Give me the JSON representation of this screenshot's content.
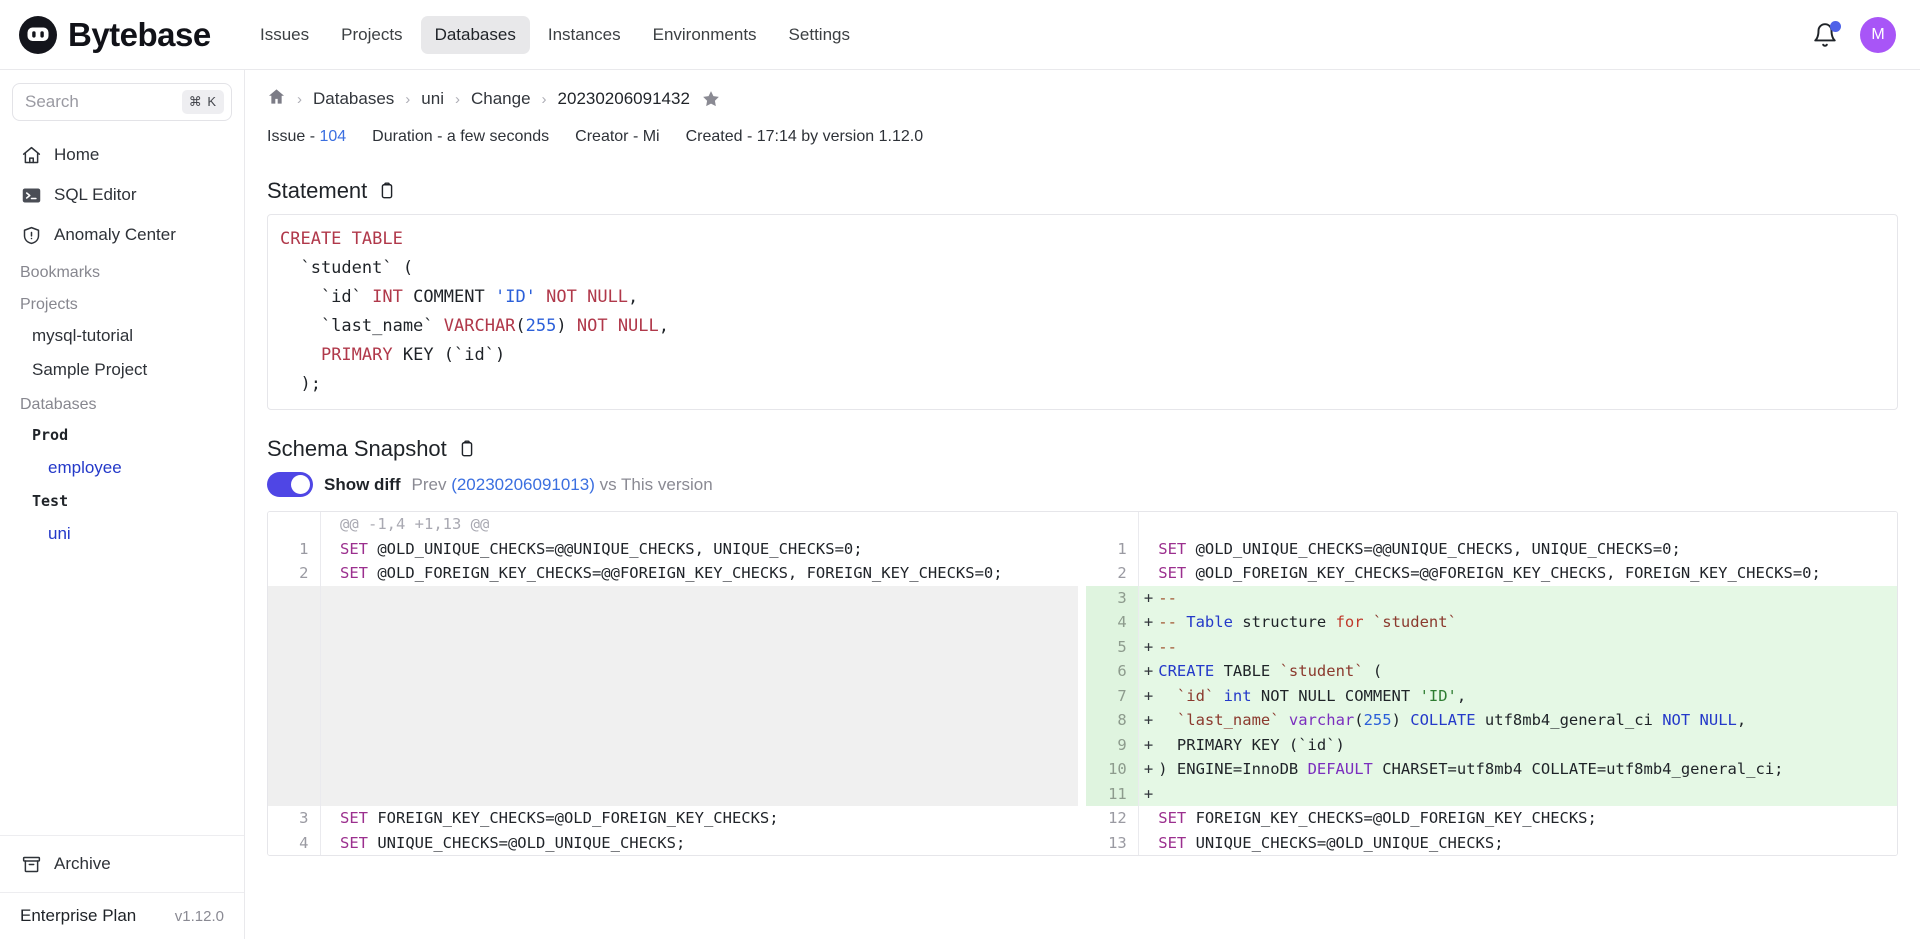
{
  "app": {
    "brand": "Bytebase"
  },
  "topnav": {
    "items": [
      {
        "label": "Issues",
        "active": false
      },
      {
        "label": "Projects",
        "active": false
      },
      {
        "label": "Databases",
        "active": true
      },
      {
        "label": "Instances",
        "active": false
      },
      {
        "label": "Environments",
        "active": false
      },
      {
        "label": "Settings",
        "active": false
      }
    ],
    "notification_icon": "bell-icon",
    "avatar_initial": "M",
    "accent": "#4f46e5"
  },
  "sidebar": {
    "search": {
      "placeholder": "Search",
      "shortcut": "⌘ K"
    },
    "nav": [
      {
        "label": "Home",
        "icon": "home-icon"
      },
      {
        "label": "SQL Editor",
        "icon": "terminal-icon"
      },
      {
        "label": "Anomaly Center",
        "icon": "shield-alert-icon"
      }
    ],
    "bookmarks_header": "Bookmarks",
    "projects_header": "Projects",
    "projects": [
      {
        "label": "mysql-tutorial"
      },
      {
        "label": "Sample Project"
      }
    ],
    "databases_header": "Databases",
    "environments": [
      {
        "label": "Prod",
        "databases": [
          {
            "label": "employee"
          }
        ]
      },
      {
        "label": "Test",
        "databases": [
          {
            "label": "uni"
          }
        ]
      }
    ],
    "archive": {
      "label": "Archive",
      "icon": "archive-icon"
    },
    "plan": {
      "name": "Enterprise Plan",
      "version": "v1.12.0"
    }
  },
  "breadcrumb": {
    "home_icon": "home-icon",
    "items": [
      {
        "label": "Databases",
        "link": true
      },
      {
        "label": "uni",
        "link": true
      },
      {
        "label": "Change",
        "link": true
      },
      {
        "label": "20230206091432",
        "link": false
      }
    ],
    "separator": "›",
    "star_icon": "star-filled-icon"
  },
  "meta": {
    "issue_label": "Issue - ",
    "issue_value": "104",
    "duration": "Duration - a few seconds",
    "creator": "Creator - Mi",
    "created": "Created - 17:14 by version 1.12.0"
  },
  "statement": {
    "title": "Statement",
    "copy_icon": "clipboard-icon",
    "lines": [
      [
        {
          "t": "CREATE TABLE",
          "c": "k"
        }
      ],
      [
        {
          "t": "  `student` (",
          "c": "p"
        }
      ],
      [
        {
          "t": "    `id` ",
          "c": "p"
        },
        {
          "t": "INT",
          "c": "k"
        },
        {
          "t": " COMMENT ",
          "c": "p"
        },
        {
          "t": "'ID'",
          "c": "n"
        },
        {
          "t": " NOT NULL",
          "c": "k"
        },
        {
          "t": ",",
          "c": "p"
        }
      ],
      [
        {
          "t": "    `last_name` ",
          "c": "p"
        },
        {
          "t": "VARCHAR",
          "c": "k"
        },
        {
          "t": "(",
          "c": "p"
        },
        {
          "t": "255",
          "c": "n"
        },
        {
          "t": ")",
          "c": "p"
        },
        {
          "t": " NOT NULL",
          "c": "k"
        },
        {
          "t": ",",
          "c": "p"
        }
      ],
      [
        {
          "t": "    ",
          "c": "p"
        },
        {
          "t": "PRIMARY",
          "c": "k"
        },
        {
          "t": " KEY (`id`)",
          "c": "p"
        }
      ],
      [
        {
          "t": "  );",
          "c": "p"
        }
      ]
    ]
  },
  "schema_snapshot": {
    "title": "Schema Snapshot",
    "copy_icon": "clipboard-icon",
    "show_diff_label": "Show diff",
    "toggle_on": true,
    "prev_label": "Prev",
    "prev_version": "(20230206091013)",
    "vs_label": "vs This version"
  },
  "diff": {
    "hunk_header": "@@ -1,4 +1,13 @@",
    "rows": [
      {
        "type": "hunk",
        "left_num": "",
        "right_num": "",
        "left": [],
        "right": []
      },
      {
        "type": "ctx",
        "left_num": "1",
        "right_num": "1",
        "left": [
          {
            "t": "SET",
            "c": "dk"
          },
          {
            "t": " @OLD_UNIQUE_CHECKS=@@UNIQUE_CHECKS, UNIQUE_CHECKS=0;",
            "c": ""
          }
        ],
        "right": [
          {
            "t": "SET",
            "c": "dk"
          },
          {
            "t": " @OLD_UNIQUE_CHECKS=@@UNIQUE_CHECKS, UNIQUE_CHECKS=0;",
            "c": ""
          }
        ]
      },
      {
        "type": "ctx",
        "left_num": "2",
        "right_num": "2",
        "left": [
          {
            "t": "SET",
            "c": "dk"
          },
          {
            "t": " @OLD_FOREIGN_KEY_CHECKS=@@FOREIGN_KEY_CHECKS, FOREIGN_KEY_CHECKS=0;",
            "c": ""
          }
        ],
        "right": [
          {
            "t": "SET",
            "c": "dk"
          },
          {
            "t": " @OLD_FOREIGN_KEY_CHECKS=@@FOREIGN_KEY_CHECKS, FOREIGN_KEY_CHECKS=0;",
            "c": ""
          }
        ]
      },
      {
        "type": "add",
        "left_num": "",
        "right_num": "3",
        "left": [],
        "right": [
          {
            "t": "--",
            "c": "dc"
          }
        ]
      },
      {
        "type": "add",
        "left_num": "",
        "right_num": "4",
        "left": [],
        "right": [
          {
            "t": "-- ",
            "c": "dc"
          },
          {
            "t": "Table",
            "c": "db"
          },
          {
            "t": " structure ",
            "c": ""
          },
          {
            "t": "for",
            "c": "dr"
          },
          {
            "t": " `student`",
            "c": "dbr"
          }
        ]
      },
      {
        "type": "add",
        "left_num": "",
        "right_num": "5",
        "left": [],
        "right": [
          {
            "t": "--",
            "c": "dc"
          }
        ]
      },
      {
        "type": "add",
        "left_num": "",
        "right_num": "6",
        "left": [],
        "right": [
          {
            "t": "CREATE",
            "c": "db"
          },
          {
            "t": " TABLE ",
            "c": ""
          },
          {
            "t": "`student`",
            "c": "dbr"
          },
          {
            "t": " (",
            "c": ""
          }
        ]
      },
      {
        "type": "add",
        "left_num": "",
        "right_num": "7",
        "left": [],
        "right": [
          {
            "t": "  `id` ",
            "c": "dbr"
          },
          {
            "t": "int",
            "c": "db"
          },
          {
            "t": " NOT NULL COMMENT ",
            "c": ""
          },
          {
            "t": "'ID'",
            "c": "ds"
          },
          {
            "t": ",",
            "c": ""
          }
        ]
      },
      {
        "type": "add",
        "left_num": "",
        "right_num": "8",
        "left": [],
        "right": [
          {
            "t": "  `last_name` ",
            "c": "dbr"
          },
          {
            "t": "varchar",
            "c": "dp"
          },
          {
            "t": "(",
            "c": ""
          },
          {
            "t": "255",
            "c": "dn"
          },
          {
            "t": ") ",
            "c": ""
          },
          {
            "t": "COLLATE",
            "c": "db"
          },
          {
            "t": " utf8mb4_general_ci ",
            "c": ""
          },
          {
            "t": "NOT NULL",
            "c": "db"
          },
          {
            "t": ",",
            "c": ""
          }
        ]
      },
      {
        "type": "add",
        "left_num": "",
        "right_num": "9",
        "left": [],
        "right": [
          {
            "t": "  PRIMARY KEY (`id`)",
            "c": ""
          }
        ]
      },
      {
        "type": "add",
        "left_num": "",
        "right_num": "10",
        "left": [],
        "right": [
          {
            "t": ") ENGINE=InnoDB ",
            "c": ""
          },
          {
            "t": "DEFAULT",
            "c": "dp"
          },
          {
            "t": " CHARSET=utf8mb4 COLLATE=utf8mb4_general_ci;",
            "c": ""
          }
        ]
      },
      {
        "type": "add",
        "left_num": "",
        "right_num": "11",
        "left": [],
        "right": [
          {
            "t": "",
            "c": ""
          }
        ]
      },
      {
        "type": "ctx",
        "left_num": "3",
        "right_num": "12",
        "left": [
          {
            "t": "SET",
            "c": "dk"
          },
          {
            "t": " FOREIGN_KEY_CHECKS=@OLD_FOREIGN_KEY_CHECKS;",
            "c": ""
          }
        ],
        "right": [
          {
            "t": "SET",
            "c": "dk"
          },
          {
            "t": " FOREIGN_KEY_CHECKS=@OLD_FOREIGN_KEY_CHECKS;",
            "c": ""
          }
        ]
      },
      {
        "type": "ctx",
        "left_num": "4",
        "right_num": "13",
        "left": [
          {
            "t": "SET",
            "c": "dk"
          },
          {
            "t": " UNIQUE_CHECKS=@OLD_UNIQUE_CHECKS;",
            "c": ""
          }
        ],
        "right": [
          {
            "t": "SET",
            "c": "dk"
          },
          {
            "t": " UNIQUE_CHECKS=@OLD_UNIQUE_CHECKS;",
            "c": ""
          }
        ]
      }
    ]
  }
}
